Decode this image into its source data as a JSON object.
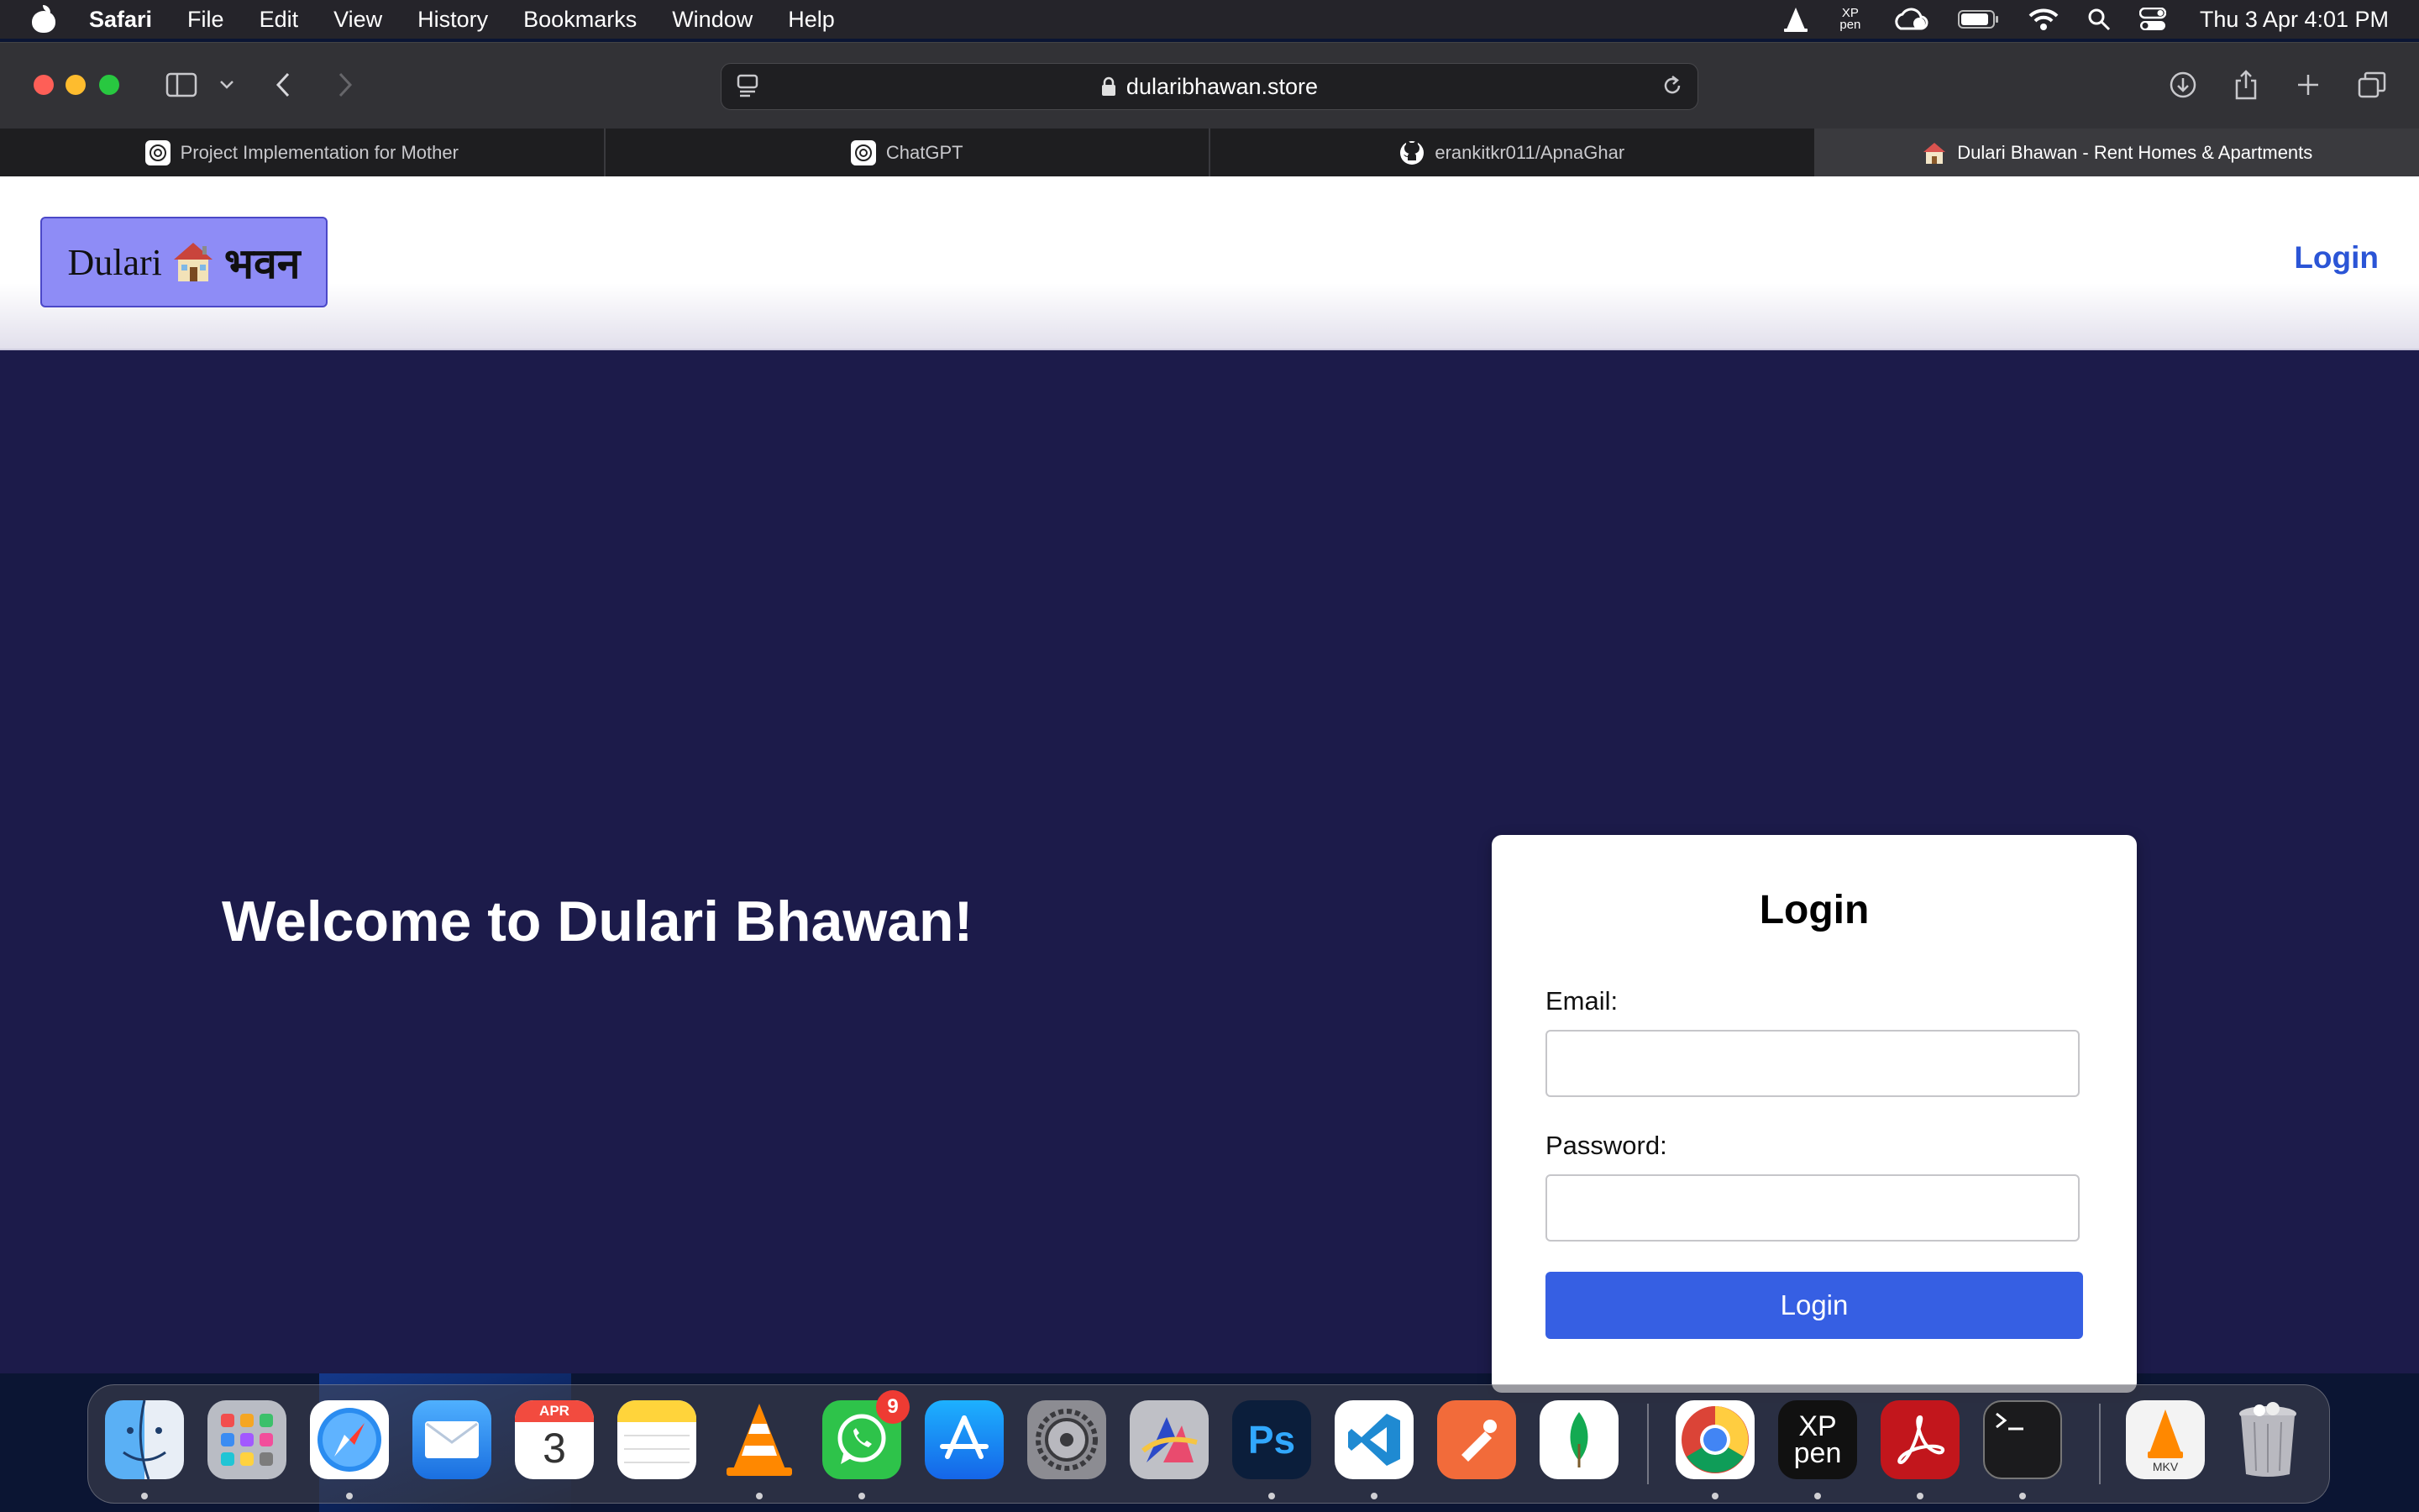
{
  "menubar": {
    "app_name": "Safari",
    "items": [
      "File",
      "Edit",
      "View",
      "History",
      "Bookmarks",
      "Window",
      "Help"
    ],
    "clock": "Thu 3 Apr  4:01 PM",
    "status_icons": [
      "vlc-icon",
      "xp-pen-icon",
      "creative-cloud-icon",
      "battery-icon",
      "wifi-icon",
      "spotlight-search-icon",
      "control-center-icon"
    ],
    "xppen_label": "XP pen"
  },
  "browser": {
    "url": "dularibhawan.store",
    "tabs": [
      {
        "title": "Project Implementation for Mother",
        "icon": "chatgpt-icon",
        "active": false
      },
      {
        "title": "ChatGPT",
        "icon": "chatgpt-icon",
        "active": false
      },
      {
        "title": "erankitkr011/ApnaGhar",
        "icon": "github-icon",
        "active": false
      },
      {
        "title": "Dulari Bhawan - Rent Homes & Apartments",
        "icon": "house-icon",
        "active": true
      }
    ]
  },
  "site": {
    "logo": {
      "latin": "Dulari",
      "hindi": "भवन"
    },
    "nav_login": "Login",
    "welcome": "Welcome to Dulari Bhawan!"
  },
  "login_form": {
    "title": "Login",
    "email_label": "Email:",
    "email_value": "",
    "password_label": "Password:",
    "password_value": "",
    "submit_label": "Login"
  },
  "dock": {
    "apps": [
      "Finder",
      "Launchpad",
      "Safari",
      "Mail",
      "Calendar",
      "Notes",
      "VLC",
      "WhatsApp",
      "App Store",
      "System Settings",
      "Affinity",
      "Photoshop",
      "Visual Studio Code",
      "Postman",
      "MongoDB Compass",
      "Google Chrome",
      "XP-Pen",
      "Adobe Acrobat",
      "Terminal",
      "MKV Video",
      "Trash"
    ],
    "calendar_month": "APR",
    "calendar_day": "3",
    "whatsapp_badge": "9",
    "photoshop_label": "Ps",
    "xppen_label": "XP pen",
    "mkv_label": "MKV"
  },
  "colors": {
    "page_bg": "#1c1b4a",
    "accent": "#365fe3",
    "logo_bg": "#8e8cf6"
  }
}
